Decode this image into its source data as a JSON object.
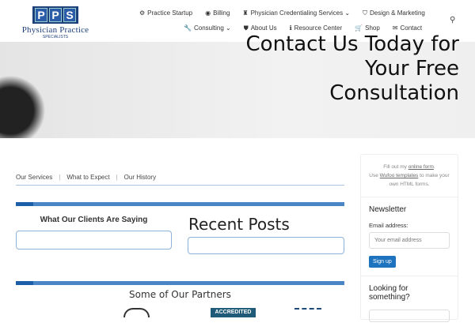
{
  "logo": {
    "letters": [
      "P",
      "P",
      "S"
    ],
    "name": "Physician Practice",
    "sub": "SPECIALISTS"
  },
  "nav": {
    "row1": [
      {
        "icon": "⚙",
        "label": "Practice Startup"
      },
      {
        "icon": "◉",
        "label": "Billing"
      },
      {
        "icon": "♜",
        "label": "Physician Credentialing Services ⌄"
      },
      {
        "icon": "⛉",
        "label": "Design & Marketing"
      }
    ],
    "row2": [
      {
        "icon": "🔧",
        "label": "Consulting ⌄"
      },
      {
        "icon": "⛊",
        "label": "About Us"
      },
      {
        "icon": "ℹ",
        "label": "Resource Center"
      },
      {
        "icon": "🛒",
        "label": "Shop"
      },
      {
        "icon": "✉",
        "label": "Contact"
      }
    ],
    "search_icon": "⚲"
  },
  "hero": {
    "title": [
      "Contact Us Today for",
      "Your Free",
      "Consultation"
    ]
  },
  "tabs": [
    "Our Services",
    "What to Expect",
    "Our History"
  ],
  "clients_heading": "What Our Clients Are Saying",
  "posts_heading": "Recent Posts",
  "partners_heading": "Some of Our Partners",
  "partner_seal_text": "ACCREDITED",
  "sidebar": {
    "form_pre": "Fill out my ",
    "form_link": "online form",
    "form_post": ".",
    "wufoo_pre": "Use ",
    "wufoo_link": "Wufoo templates",
    "wufoo_post": " to make your own HTML forms.",
    "newsletter_title": "Newsletter",
    "email_label": "Email address:",
    "email_placeholder": "Your email address",
    "signup": "Sign up",
    "search_title": "Looking for something?"
  }
}
